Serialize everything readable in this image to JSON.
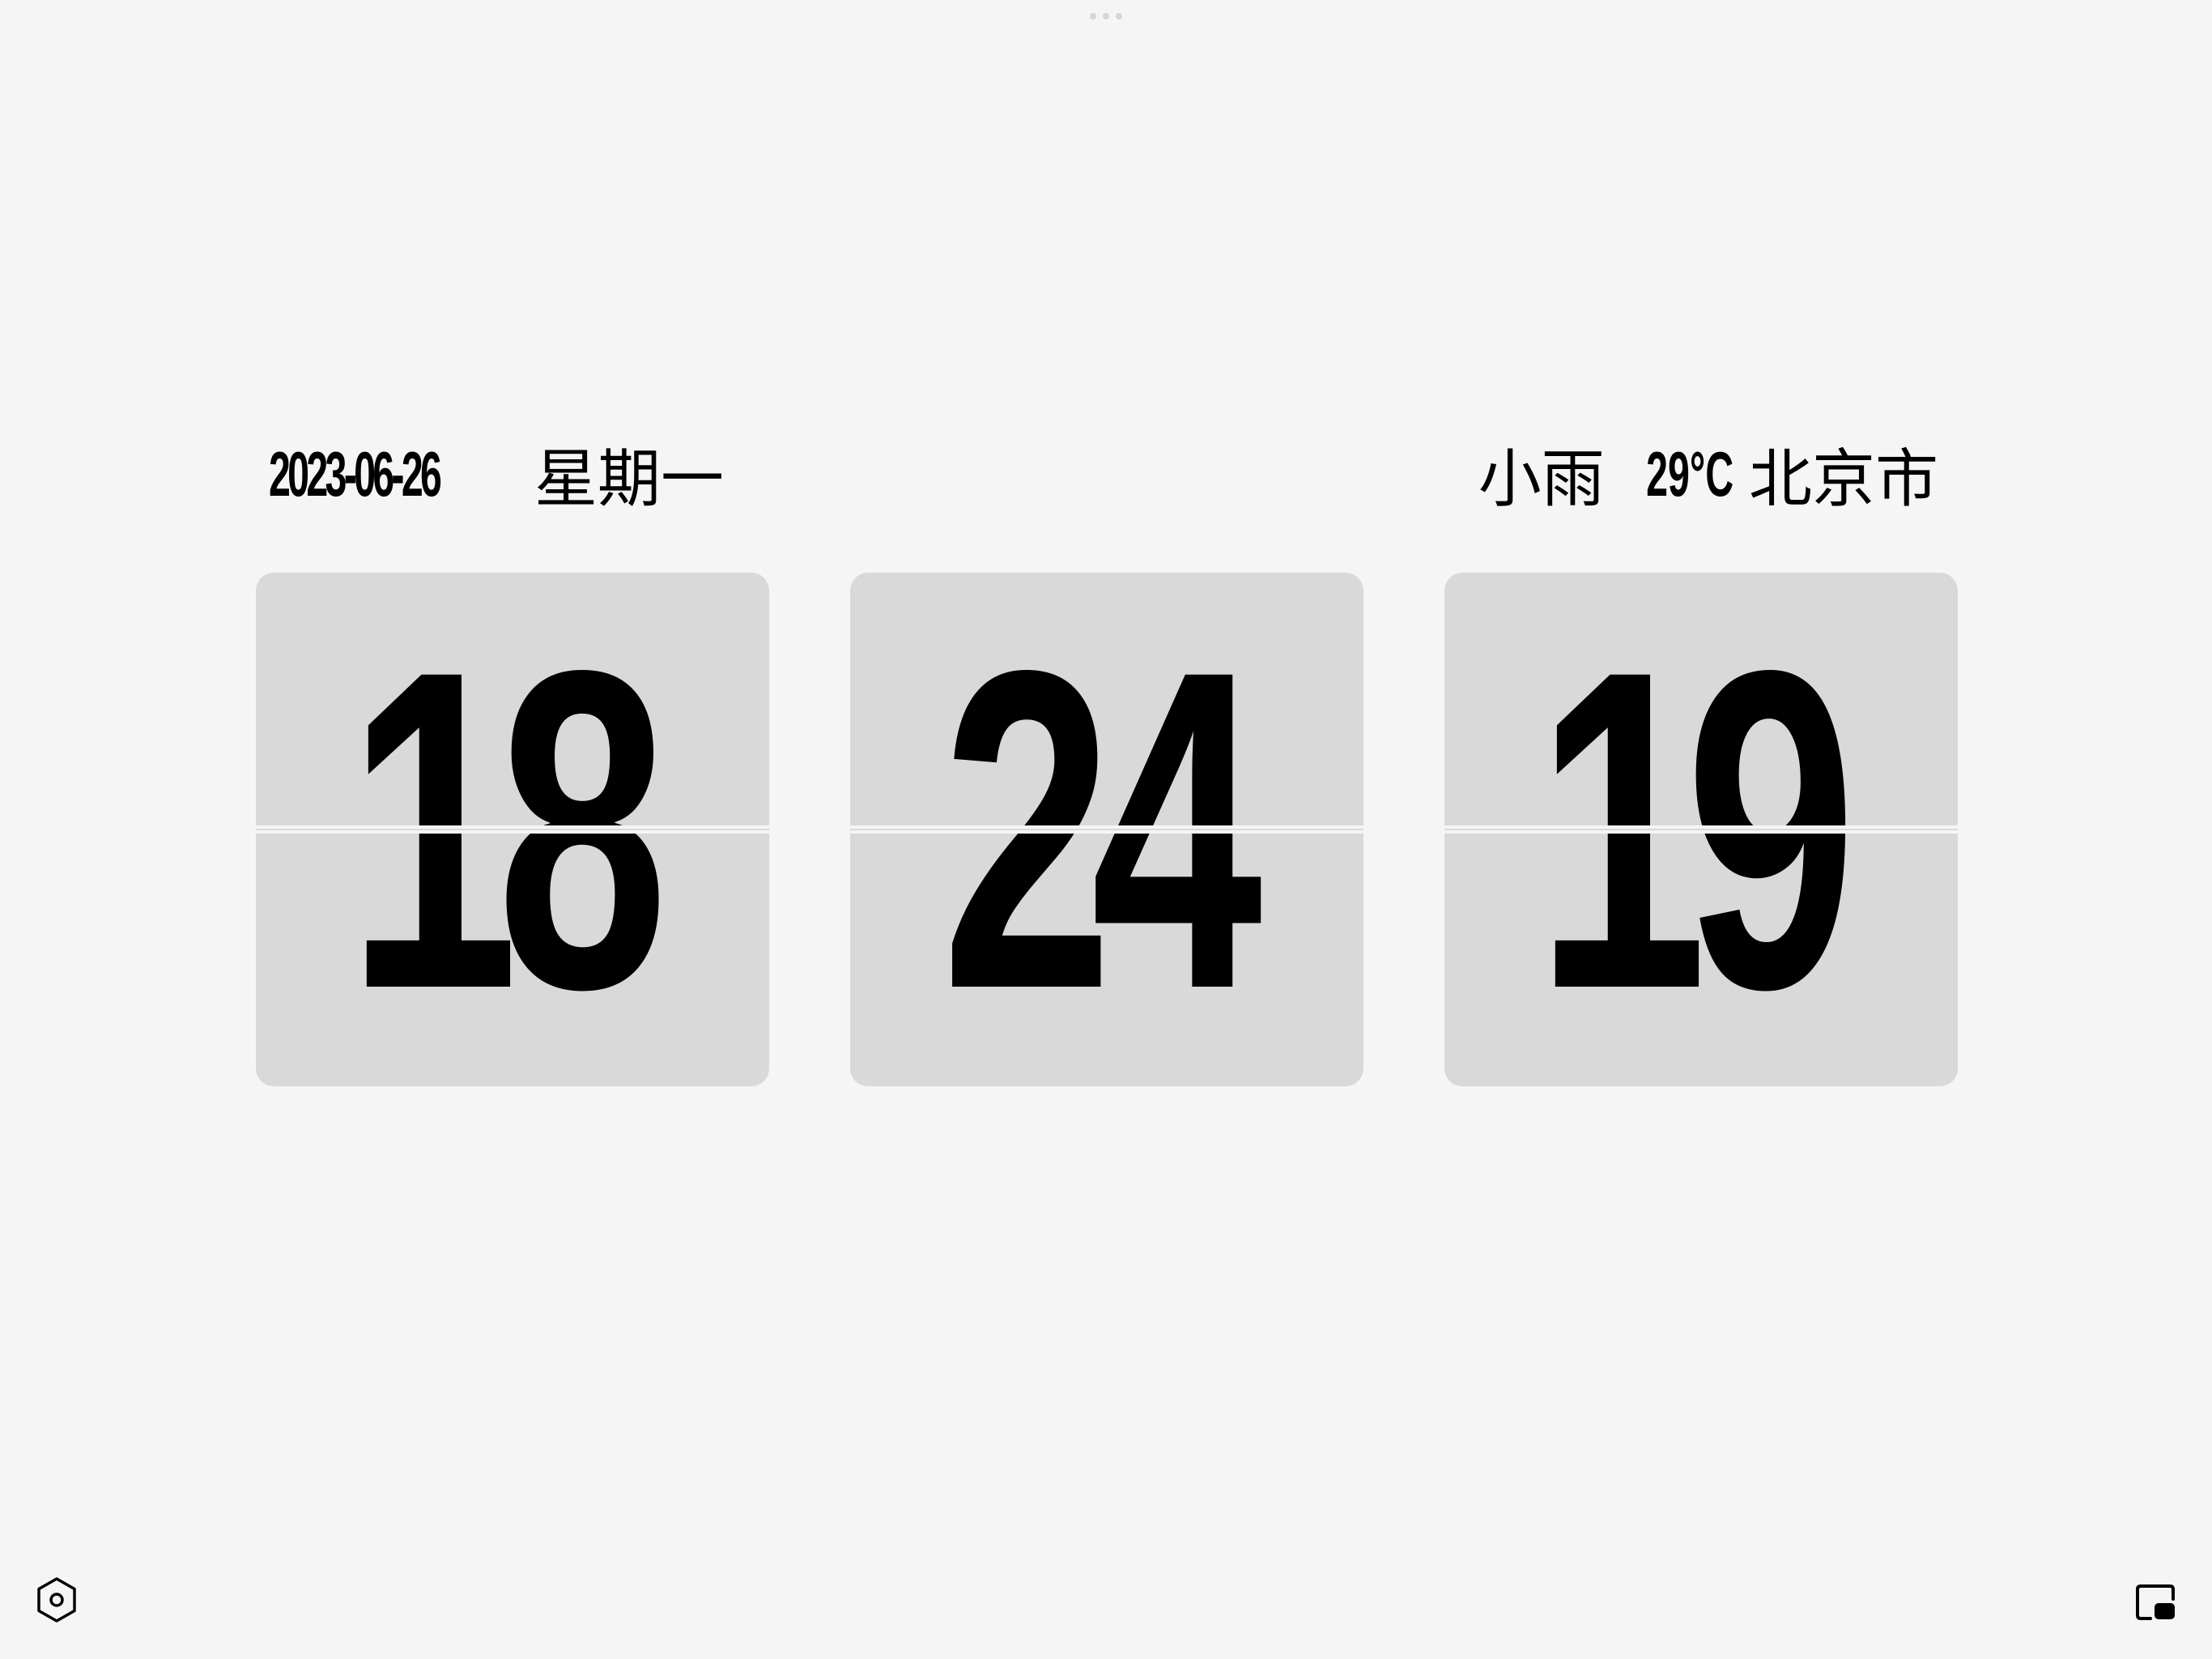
{
  "date": {
    "text": "2023-06-26",
    "weekday": "星期一"
  },
  "weather": {
    "condition": "小雨",
    "temperature": "29°C",
    "city": "北京市"
  },
  "clock": {
    "hours": "18",
    "minutes": "24",
    "seconds": "19"
  },
  "icons": {
    "settings": "settings-hexagon-icon",
    "screen_mode": "screen-mode-icon"
  },
  "colors": {
    "background": "#f5f5f5",
    "card": "#d9d9d9",
    "text": "#000000"
  }
}
